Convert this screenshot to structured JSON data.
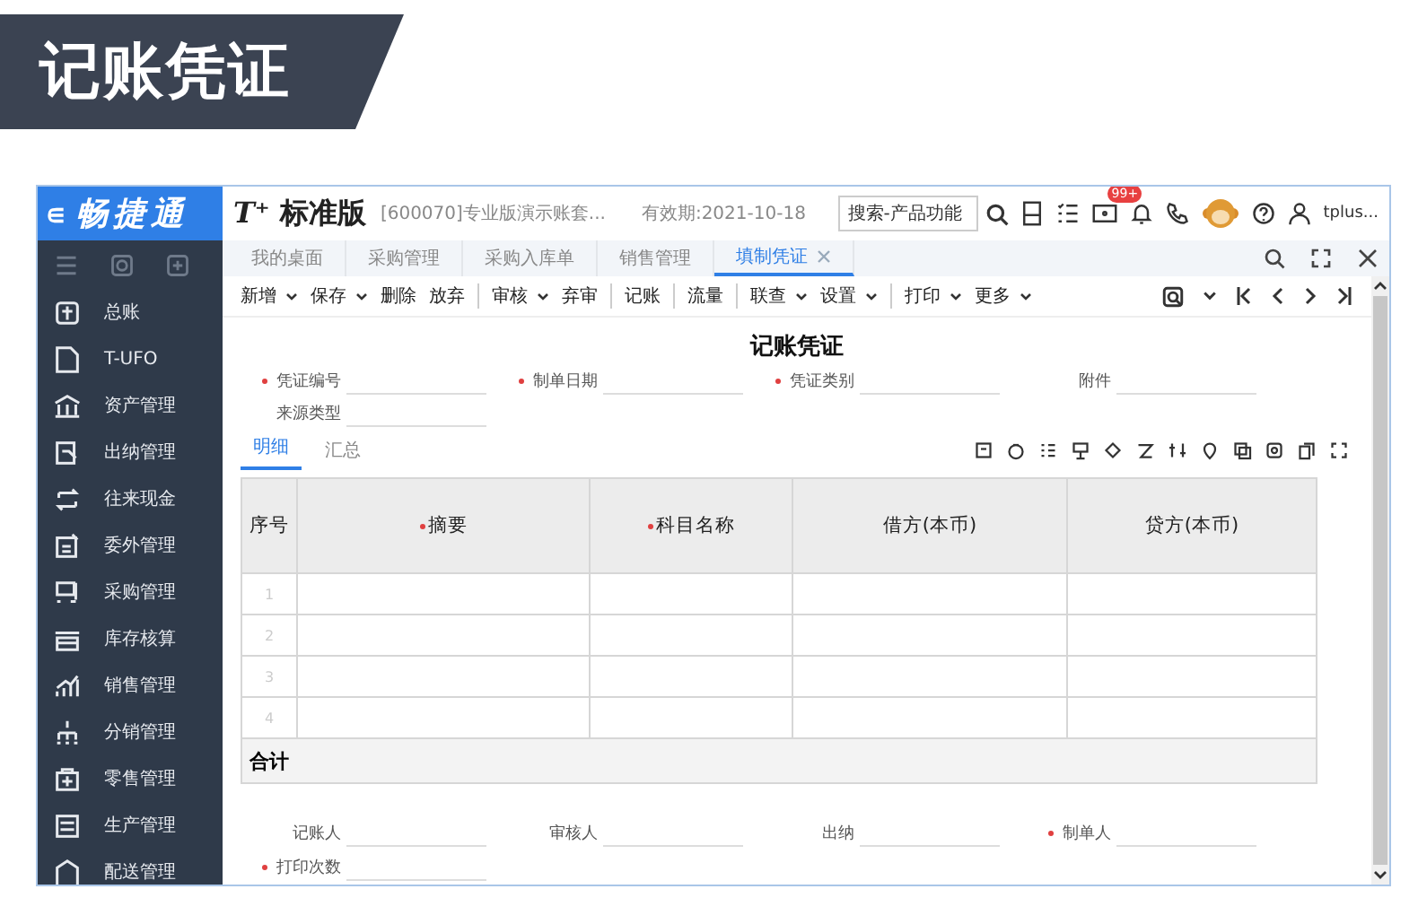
{
  "banner": {
    "title": "记账凭证"
  },
  "sidebar": {
    "logo": "畅捷通",
    "back_glyph": "∊",
    "items": [
      {
        "label": "总账"
      },
      {
        "label": "T-UFO"
      },
      {
        "label": "资产管理"
      },
      {
        "label": "出纳管理"
      },
      {
        "label": "往来现金"
      },
      {
        "label": "委外管理"
      },
      {
        "label": "采购管理"
      },
      {
        "label": "库存核算"
      },
      {
        "label": "销售管理"
      },
      {
        "label": "分销管理"
      },
      {
        "label": "零售管理"
      },
      {
        "label": "生产管理"
      },
      {
        "label": "配送管理"
      }
    ]
  },
  "header": {
    "product_mark": "T⁺",
    "product": "标准版",
    "account": "[600070]专业版演示账套...",
    "validity": "有效期:2021-10-18",
    "search_placeholder": "搜索-产品功能",
    "badge": "99+",
    "user": "tplus..."
  },
  "tabs": [
    {
      "label": "我的桌面",
      "selected": false,
      "closable": false
    },
    {
      "label": "采购管理",
      "selected": false,
      "closable": false
    },
    {
      "label": "采购入库单",
      "selected": false,
      "closable": false
    },
    {
      "label": "销售管理",
      "selected": false,
      "closable": false
    },
    {
      "label": "填制凭证",
      "selected": true,
      "closable": true
    }
  ],
  "toolbar": [
    {
      "label": "新增",
      "dropdown": true,
      "separator_after": false
    },
    {
      "label": "保存",
      "dropdown": true,
      "separator_after": false
    },
    {
      "label": "删除",
      "dropdown": false,
      "separator_after": false
    },
    {
      "label": "放弃",
      "dropdown": false,
      "separator_after": true
    },
    {
      "label": "审核",
      "dropdown": true,
      "separator_after": false
    },
    {
      "label": "弃审",
      "dropdown": false,
      "separator_after": true
    },
    {
      "label": "记账",
      "dropdown": false,
      "separator_after": true
    },
    {
      "label": "流量",
      "dropdown": false,
      "separator_after": true
    },
    {
      "label": "联查",
      "dropdown": true,
      "separator_after": false
    },
    {
      "label": "设置",
      "dropdown": true,
      "separator_after": true
    },
    {
      "label": "打印",
      "dropdown": true,
      "separator_after": false
    },
    {
      "label": "更多",
      "dropdown": true,
      "separator_after": false
    }
  ],
  "form": {
    "title": "记账凭证",
    "fields": [
      {
        "label": "凭证编号",
        "required": true
      },
      {
        "label": "制单日期",
        "required": true
      },
      {
        "label": "凭证类别",
        "required": true
      },
      {
        "label": "附件",
        "required": false
      },
      {
        "label": "来源类型",
        "required": false
      }
    ],
    "detail_tabs": [
      {
        "label": "明细",
        "selected": true
      },
      {
        "label": "汇总",
        "selected": false
      }
    ],
    "table": {
      "columns": [
        {
          "label": "序号",
          "required": false
        },
        {
          "label": "摘要",
          "required": true
        },
        {
          "label": "科目名称",
          "required": true
        },
        {
          "label": "借方(本币)",
          "required": false
        },
        {
          "label": "贷方(本币)",
          "required": false
        }
      ],
      "rows": [
        "1",
        "2",
        "3",
        "4"
      ],
      "total_label": "合计"
    },
    "footer_fields": [
      {
        "label": "记账人",
        "required": false
      },
      {
        "label": "审核人",
        "required": false
      },
      {
        "label": "出纳",
        "required": false
      },
      {
        "label": "制单人",
        "required": true
      },
      {
        "label": "打印次数",
        "required": true
      }
    ]
  }
}
